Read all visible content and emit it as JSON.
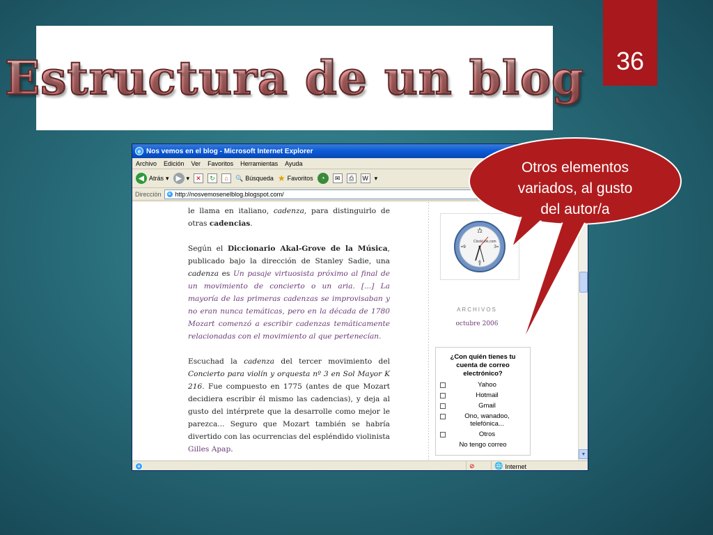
{
  "slide": {
    "title": "Estructura de un blog",
    "page_number": "36",
    "callout_text": "Otros elementos variados, al gusto del autor/a",
    "colors": {
      "accent_red": "#a8181c",
      "background": "#2a6f7c"
    }
  },
  "browser": {
    "window_title": "Nos vemos en el blog - Microsoft Internet Explorer",
    "menu": [
      "Archivo",
      "Edición",
      "Ver",
      "Favoritos",
      "Herramientas",
      "Ayuda"
    ],
    "toolbar": {
      "back_label": "Atrás",
      "search_label": "Búsqueda",
      "favorites_label": "Favoritos"
    },
    "address": {
      "label": "Dirección",
      "url": "http://nosvemosenelblog.blogspot.com/"
    },
    "status": {
      "zone": "Internet"
    }
  },
  "article": {
    "p1_a": "le llama en italiano, ",
    "p1_b": "cadenza",
    "p1_c": ", para distinguirlo de otras ",
    "p1_d": "cadencias",
    "p1_e": ".",
    "p2_a": "Según el ",
    "p2_b": "Diccionario Akal-Grove de la Música",
    "p2_c": ", publicado bajo la dirección de Stanley Sadie, una ",
    "p2_d": "cadenza",
    "p2_e": " es ",
    "p2_quote": "Un pasaje virtuosista próximo al final de un movimiento de concierto o un aria. [...] La mayoría de las primeras cadenzas se improvisaban y no eran nunca temáticas, pero en la década de 1780 Mozart comenzó a escribir cadenzas temáticamente relacionadas con el movimiento al que pertenecían.",
    "p3_a": "Escuchad la ",
    "p3_b": "cadenza",
    "p3_c": " del tercer movimiento del ",
    "p3_d": "Concierto para violín y orquesta nº 3 en Sol Mayor K 216",
    "p3_e": ". Fue compuesto en 1775 (antes de que Mozart decidiera escribir él mismo las cadencias), y deja al gusto del intérprete que la desarrolle como mejor le parezca... Seguro que Mozart también se habría divertido con las ocurrencias del espléndido violinista ",
    "p3_link": "Gilles Apap",
    "p3_f": "."
  },
  "sidebar": {
    "clock_brand": "ClockLink.com",
    "archives_title": "ARCHIVOS",
    "archives_link": "octubre 2006",
    "poll_question": "¿Con quién tienes tu cuenta de correo electrónico?",
    "poll_options": [
      "Yahoo",
      "Hotmail",
      "Gmail",
      "Ono, wanadoo, telefónica...",
      "Otros"
    ],
    "poll_tail": "No tengo correo"
  }
}
